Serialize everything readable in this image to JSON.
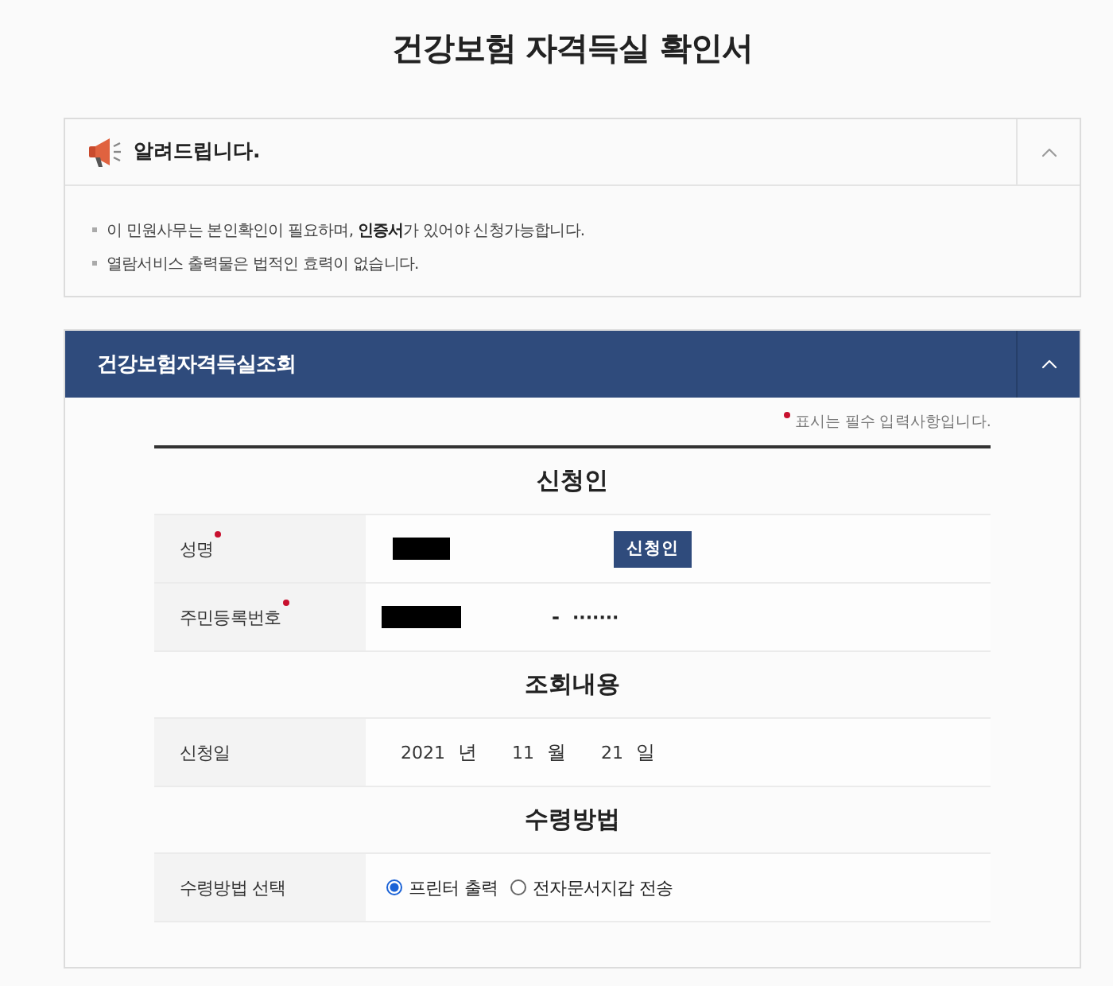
{
  "title": "건강보험 자격득실 확인서",
  "notice": {
    "title": "알려드립니다.",
    "expanded": true,
    "items": [
      "이 민원사무는 본인확인이 필요하며, **인증서**가 있어야 신청가능합니다.",
      "열람서비스 출력물은 법적인 효력이 없습니다."
    ]
  },
  "panel": {
    "title": "건강보험자격득실조회",
    "expanded": true,
    "required_note": "표시는 필수 입력사항입니다.",
    "sections": [
      {
        "heading": "신청인",
        "rows": [
          {
            "kind": "name",
            "label": "성명",
            "required": true,
            "redacted": true,
            "button": "신청인"
          },
          {
            "kind": "id",
            "label": "주민등록번호",
            "required": true,
            "redacted": true,
            "separator": "-",
            "masked": "·······"
          }
        ]
      },
      {
        "heading": "조회내용",
        "rows": [
          {
            "kind": "date",
            "label": "신청일",
            "required": false,
            "parts": [
              {
                "value": "2021",
                "unit": "년"
              },
              {
                "value": "11",
                "unit": "월"
              },
              {
                "value": "21",
                "unit": "일"
              }
            ]
          }
        ]
      },
      {
        "heading": "수령방법",
        "rows": [
          {
            "kind": "radio",
            "label": "수령방법 선택",
            "required": false,
            "options": [
              {
                "label": "프린터 출력",
                "selected": true
              },
              {
                "label": "전자문서지갑 전송",
                "selected": false
              }
            ]
          }
        ]
      }
    ]
  }
}
